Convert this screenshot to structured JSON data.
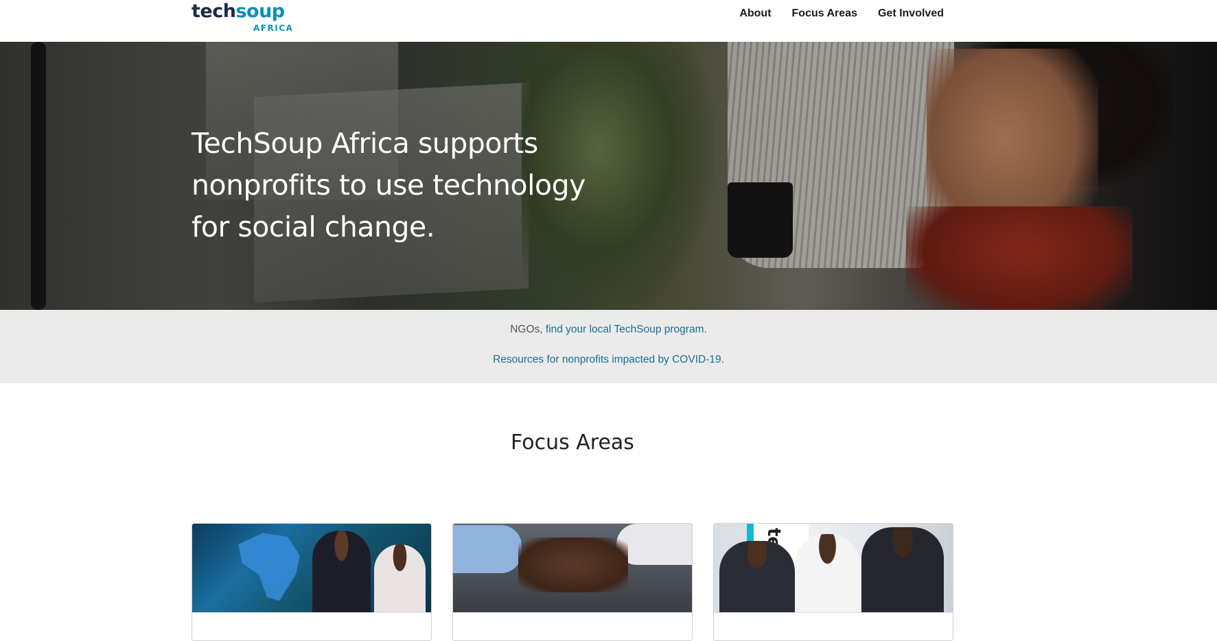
{
  "header": {
    "logo": {
      "main_part1": "tech",
      "main_part2": "soup",
      "sub": "AFRICA"
    },
    "nav": {
      "about": "About",
      "focus_areas": "Focus Areas",
      "get_involved": "Get Involved"
    }
  },
  "hero": {
    "headline": "TechSoup Africa supports nonprofits to use technology for social change."
  },
  "notice": {
    "line1_prefix": "NGOs, ",
    "line1_link": "find your local TechSoup program.",
    "line2_link": "Resources for nonprofits impacted by COVID-19."
  },
  "focus": {
    "title": "Focus Areas"
  },
  "cards": {
    "card3_banner_text": "techs"
  },
  "colors": {
    "brand_dark": "#1f2a44",
    "brand_blue": "#0a8fbf",
    "link": "#1a6e96",
    "notice_bg": "#ebebeb"
  }
}
